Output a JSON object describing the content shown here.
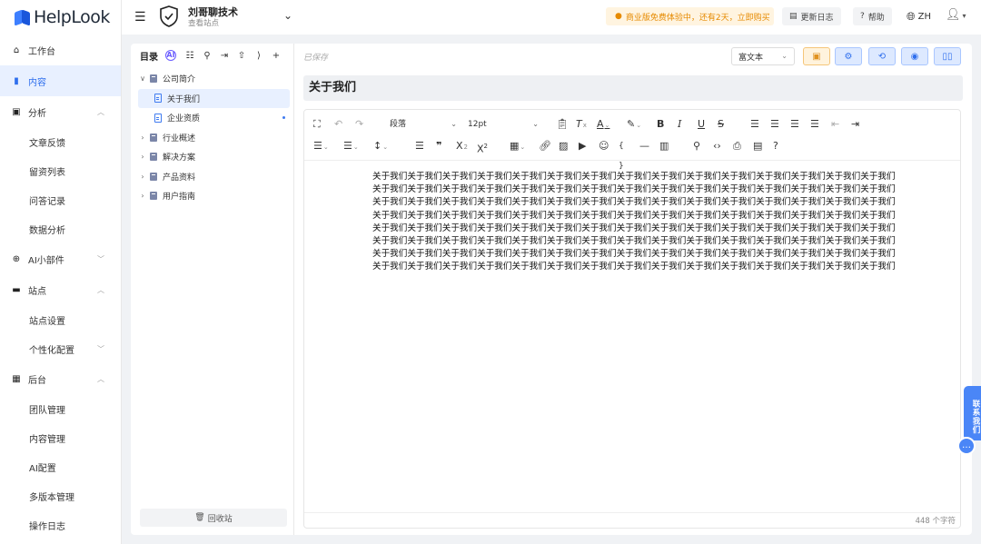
{
  "brand": {
    "name": "HelpLook"
  },
  "sidebar": {
    "items": [
      {
        "label": "工作台"
      },
      {
        "label": "内容"
      },
      {
        "label": "分析"
      },
      {
        "label": "文章反馈"
      },
      {
        "label": "留资列表"
      },
      {
        "label": "问答记录"
      },
      {
        "label": "数据分析"
      },
      {
        "label": "AI小部件"
      },
      {
        "label": "站点"
      },
      {
        "label": "站点设置"
      },
      {
        "label": "个性化配置"
      },
      {
        "label": "后台"
      },
      {
        "label": "团队管理"
      },
      {
        "label": "内容管理"
      },
      {
        "label": "AI配置"
      },
      {
        "label": "多版本管理"
      },
      {
        "label": "操作日志"
      }
    ]
  },
  "header": {
    "site_name": "刘哥聊技术",
    "site_sub": "查看站点",
    "promo": "商业版免费体验中，还有2天，立即购买",
    "changelog": "更新日志",
    "help": "帮助",
    "lang": "ZH"
  },
  "tree": {
    "title": "目录",
    "ai_badge": "AI",
    "items": [
      {
        "label": "公司简介"
      },
      {
        "label": "关于我们"
      },
      {
        "label": "企业资质"
      },
      {
        "label": "行业概述"
      },
      {
        "label": "解决方案"
      },
      {
        "label": "产品资料"
      },
      {
        "label": "用户指南"
      }
    ],
    "recycle": "回收站"
  },
  "editor": {
    "saved": "已保存",
    "mode": "富文本",
    "title": "关于我们",
    "paragraph_style": "段落",
    "font_size": "12pt",
    "body_text": "关于我们关于我们关于我们关于我们关于我们关于我们关于我们关于我们关于我们关于我们关于我们关于我们关于我们关于我们关于我们关于我们关于我们关于我们关于我们关于我们关于我们关于我们关于我们关于我们关于我们关于我们关于我们关于我们关于我们关于我们关于我们关于我们关于我们关于我们关于我们关于我们关于我们关于我们关于我们关于我们关于我们关于我们关于我们关于我们关于我们关于我们关于我们关于我们关于我们关于我们关于我们关于我们关于我们关于我们关于我们关于我们关于我们关于我们关于我们关于我们关于我们关于我们关于我们关于我们关于我们关于我们关于我们关于我们关于我们关于我们关于我们关于我们关于我们关于我们关于我们关于我们关于我们关于我们关于我们关于我们关于我们关于我们关于我们关于我们关于我们关于我们关于我们关于我们关于我们关于我们关于我们关于我们关于我们关于我们关于我们关于我们关于我们关于我们关于我们关于我们关于我们关于我们关于我们关于我们关于我们关于我们关于我们关于我们关于我们关于我们关于我们关于我们关于我们关于我们关于我们关于我们关于我们关于我们关于我们关于我们",
    "char_count": "448 个字符"
  },
  "contact": {
    "label": "联系我们"
  },
  "colors": {
    "accent": "#2f6fed",
    "promo": "#e68a00"
  }
}
